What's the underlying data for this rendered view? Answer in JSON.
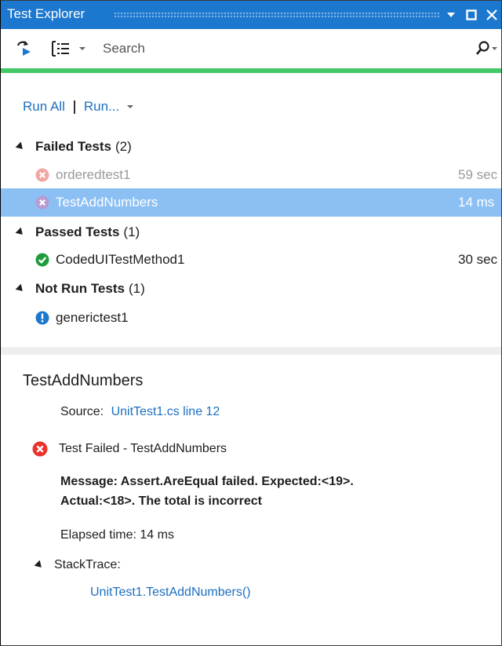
{
  "window": {
    "title": "Test Explorer",
    "buttons": [
      "dropdown-icon",
      "maximize-icon",
      "close-icon"
    ]
  },
  "toolbar": {
    "tools": [
      "run-tests-icon",
      "group-by-icon",
      "chevron-down-icon"
    ],
    "search": {
      "placeholder": "Search",
      "value": ""
    },
    "search_icon": "search-icon"
  },
  "progress": {
    "status_color": "#44c767",
    "fraction": 1.0
  },
  "actions": {
    "run_all": "Run All",
    "run": "Run..."
  },
  "groups": [
    {
      "name": "Failed Tests",
      "count": "(2)",
      "tests": [
        {
          "name": "orderedtest1",
          "time": "59 sec",
          "status": "failed",
          "dimmed": true,
          "selected": false
        },
        {
          "name": "TestAddNumbers",
          "time": "14 ms",
          "status": "failed",
          "dimmed": false,
          "selected": true
        }
      ]
    },
    {
      "name": "Passed Tests",
      "count": "(1)",
      "tests": [
        {
          "name": "CodedUITestMethod1",
          "time": "30 sec",
          "status": "passed",
          "dimmed": false,
          "selected": false
        }
      ]
    },
    {
      "name": "Not Run Tests",
      "count": "(1)",
      "tests": [
        {
          "name": "generictest1",
          "time": "",
          "status": "notrun",
          "dimmed": false,
          "selected": false
        }
      ]
    }
  ],
  "colors": {
    "accent": "#1c78cf",
    "selection": "#8cbff4",
    "fail": "#e8322a",
    "pass": "#1f9b3e",
    "info": "#1c78cf",
    "link": "#1c6fc0"
  },
  "details": {
    "title": "TestAddNumbers",
    "source_label": "Source:",
    "source_link": "UnitTest1.cs line 12",
    "result": "Test Failed - TestAddNumbers",
    "message_line1": "Message: Assert.AreEqual failed. Expected:<19>.",
    "message_line2": "Actual:<18>. The total is incorrect",
    "elapsed": "Elapsed time: 14 ms",
    "stacktrace_label": "StackTrace:",
    "stack_frame": "UnitTest1.TestAddNumbers()"
  }
}
